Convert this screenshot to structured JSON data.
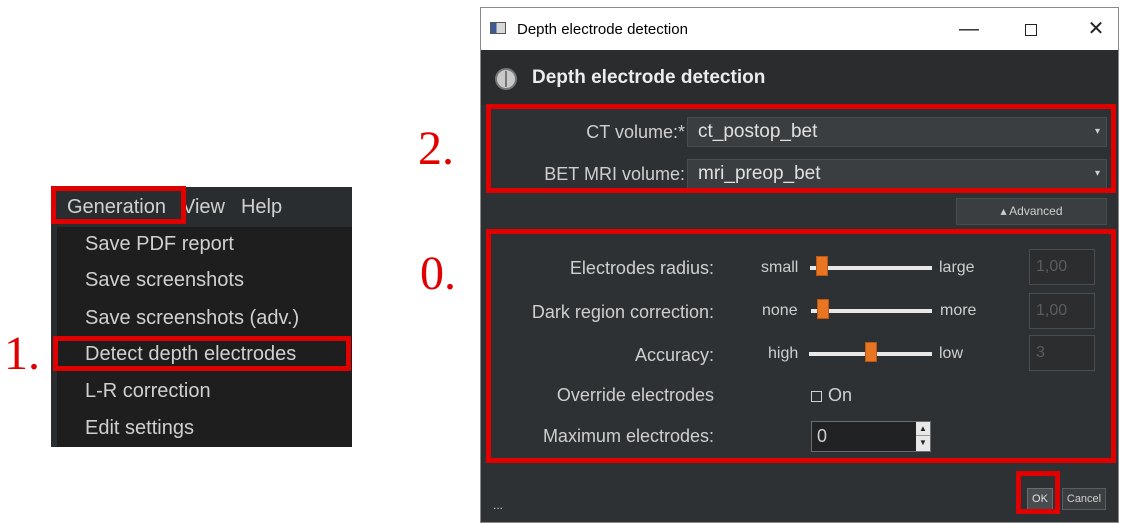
{
  "annotations": {
    "step1": "1.",
    "step2": "2.",
    "step0": "0."
  },
  "menubar": {
    "items": [
      "Generation",
      "View",
      "Help"
    ]
  },
  "menu": {
    "items": [
      "Save PDF report",
      "Save screenshots",
      "Save screenshots (adv.)",
      "Detect depth electrodes",
      "L-R correction",
      "Edit settings"
    ]
  },
  "window": {
    "title": "Depth electrode detection",
    "minimize_glyph": "—",
    "close_glyph": "✕"
  },
  "header": {
    "title": "Depth electrode detection",
    "icon": "brain-icon"
  },
  "inputs": {
    "ct_label": "CT volume:*",
    "ct_value": "ct_postop_bet",
    "mri_label": "BET MRI volume:",
    "mri_value": "mri_preop_bet",
    "arrow": "▾"
  },
  "advanced": {
    "label": "▴   Advanced"
  },
  "params": {
    "radius": {
      "label": "Electrodes radius:",
      "min_text": "small",
      "max_text": "large",
      "value": "1,00",
      "level": 0.1
    },
    "dark": {
      "label": "Dark region correction:",
      "min_text": "none",
      "max_text": "more",
      "value": "1,00",
      "level": 0.1
    },
    "accuracy": {
      "label": "Accuracy:",
      "min_text": "high",
      "max_text": "low",
      "value": "3",
      "level": 0.5
    },
    "override": {
      "label": "Override electrodes",
      "checkbox_label": "On",
      "checked": false
    },
    "max_electrodes": {
      "label": "Maximum electrodes:",
      "value": "0",
      "up": "▲",
      "down": "▼"
    }
  },
  "footer": {
    "dots": "...",
    "ok": "OK",
    "cancel": "Cancel"
  },
  "colors": {
    "annotation_red": "#e00000",
    "slider_thumb": "#e87522",
    "dialog_bg": "#2e3133"
  }
}
